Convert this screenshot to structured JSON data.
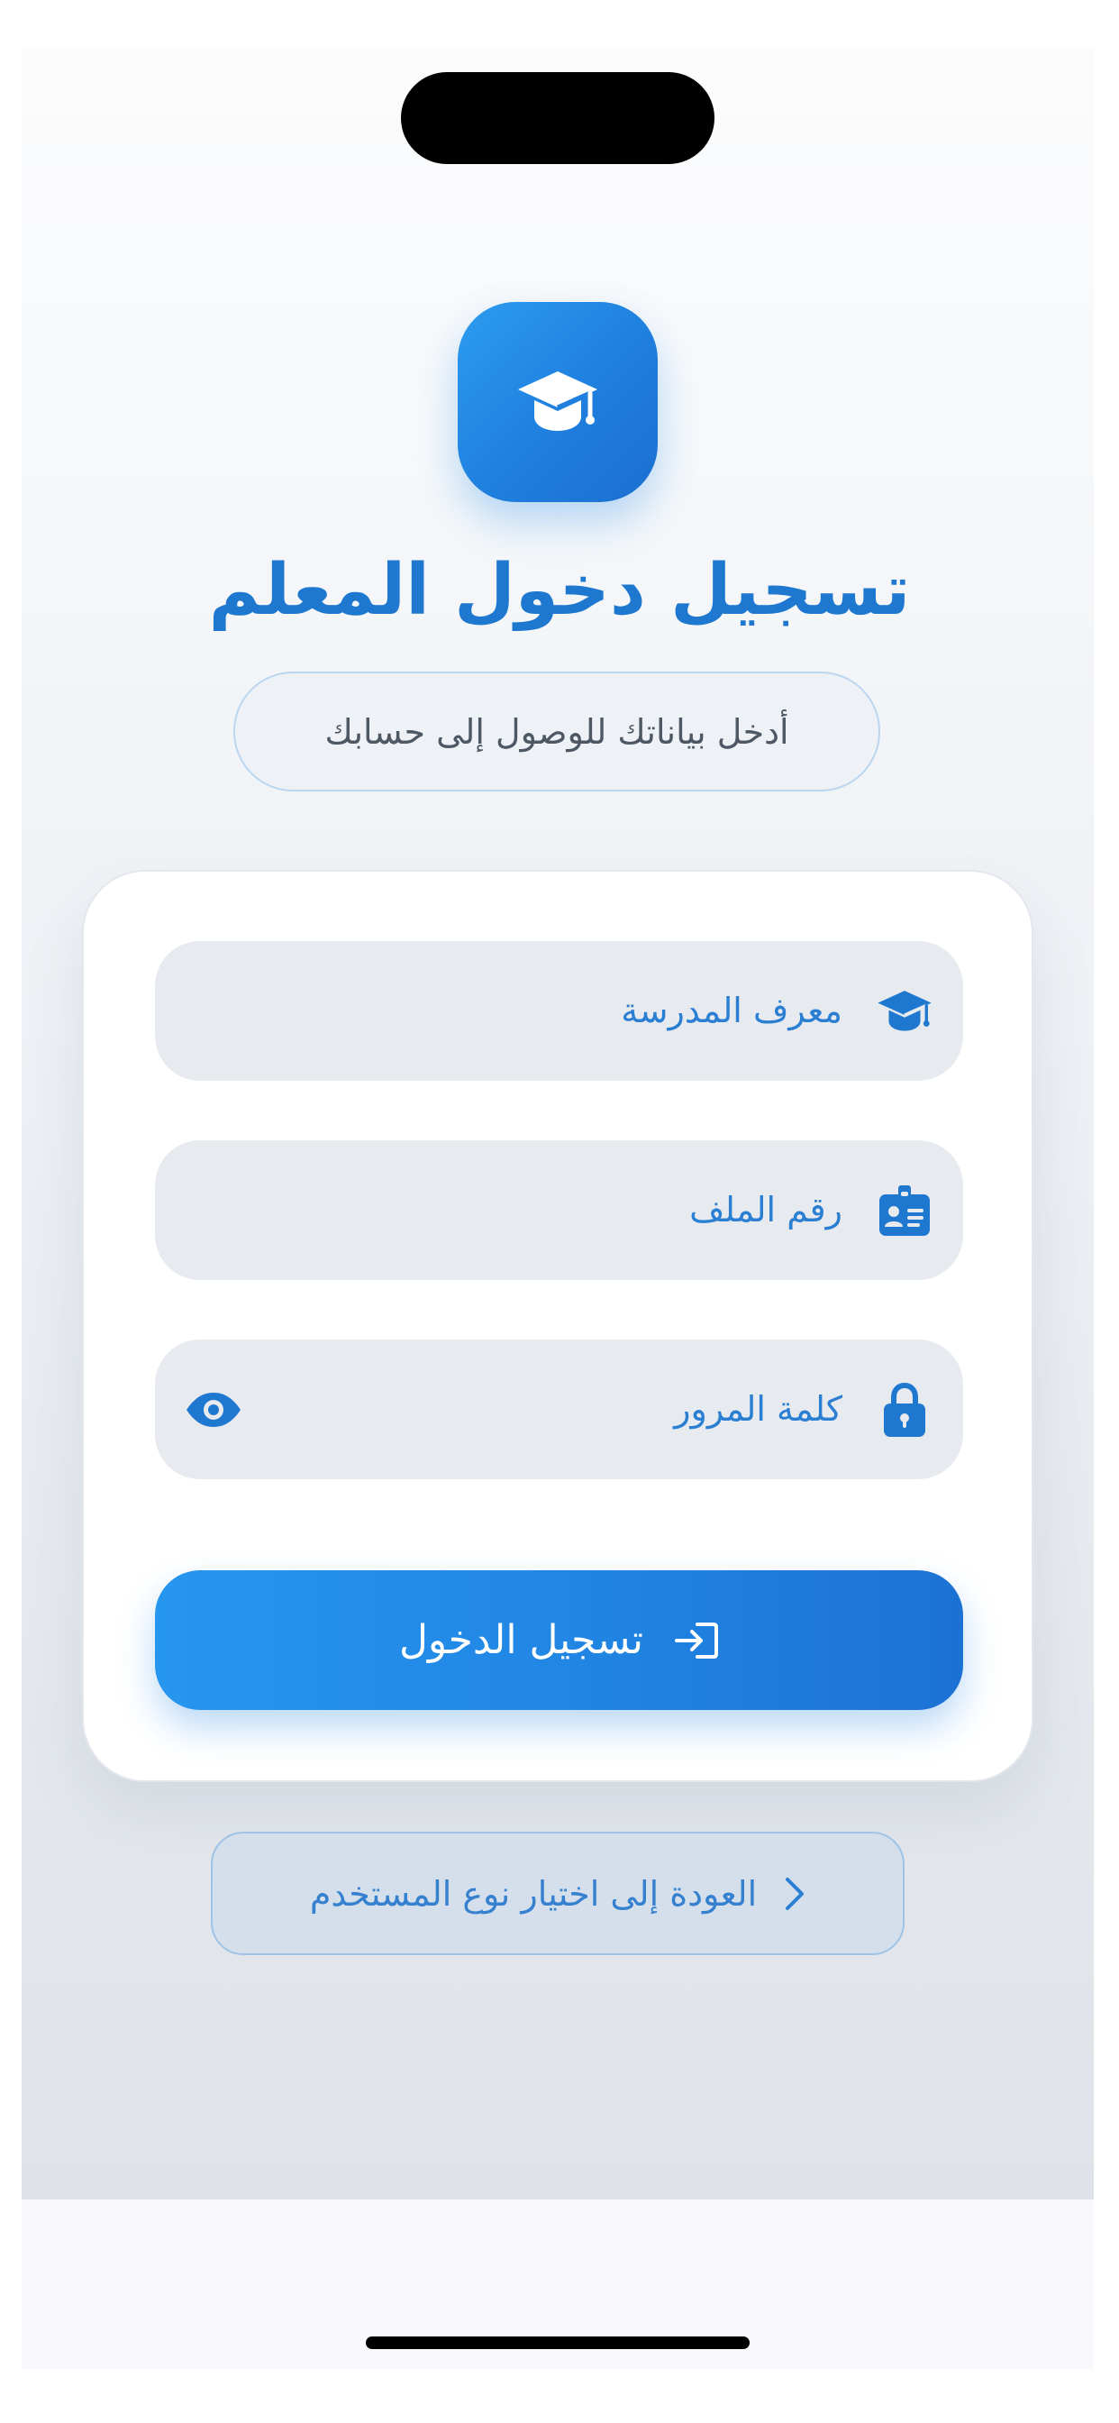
{
  "app": {
    "title": "تسجيل دخول المعلم",
    "subtitle": "أدخل بياناتك للوصول إلى حسابك",
    "logo_icon": "graduation-cap-icon"
  },
  "form": {
    "school_id": {
      "placeholder": "معرف المدرسة",
      "icon": "graduation-cap-icon"
    },
    "file_number": {
      "placeholder": "رقم الملف",
      "icon": "id-badge-icon"
    },
    "password": {
      "placeholder": "كلمة المرور",
      "icon": "lock-icon",
      "toggle_icon": "eye-icon"
    },
    "submit": {
      "label": "تسجيل الدخول",
      "icon": "sign-in-icon"
    }
  },
  "navigation": {
    "back_label": "العودة إلى اختيار نوع المستخدم",
    "back_icon": "chevron-right-icon"
  },
  "colors": {
    "primary": "#1f78d0",
    "primary_light": "#2796ef",
    "field_bg": "#e7eaee",
    "card_bg": "#ffffff"
  }
}
